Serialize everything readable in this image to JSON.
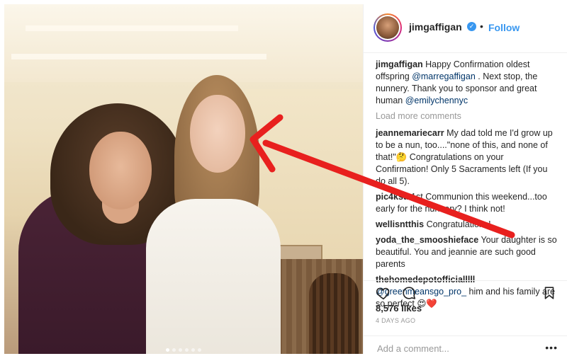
{
  "post": {
    "username": "jimgaffigan",
    "follow_label": "Follow",
    "separator": "•",
    "verified_glyph": "✓",
    "caption": {
      "user": "jimgaffigan",
      "text_1": "Happy Confirmation oldest offspring ",
      "mention_1": "@marregaffigan",
      "text_2": " . Next stop, the nunnery. Thank you to sponsor and great human ",
      "mention_2": "@emilychennyc"
    },
    "load_more_label": "Load more comments",
    "comments": [
      {
        "user": "jeannemariecarr",
        "text": "My dad told me I'd grow up to be a nun, too....\"none of this, and none of that!\"🤔 Congratulations on your Confirmation! Only 5 Sacraments left (If you do all 5)."
      },
      {
        "user": "pic4ksu",
        "text": "1st Communion this weekend...too early for the nunnery? I think not!"
      },
      {
        "user": "wellisntthis",
        "text": "Congratulations!"
      },
      {
        "user": "yoda_the_smooshieface",
        "text": "Your daughter is so beautiful. You and jeannie are such good parents"
      },
      {
        "user": "thehomedepotofficialllll",
        "mention": "@greenmeansgo_pro_",
        "text": " him and his family are so perfect 😍❤️"
      }
    ],
    "likes": "8,576 likes",
    "time_ago": "4 DAYS AGO",
    "add_comment_placeholder": "Add a comment...",
    "more_glyph": "•••"
  },
  "icons": {
    "like": "heart-icon",
    "comment": "comment-icon",
    "save": "bookmark-icon"
  },
  "colors": {
    "accent": "#3897f0",
    "annotation_arrow": "#e8201e",
    "muted_text": "#999999"
  }
}
